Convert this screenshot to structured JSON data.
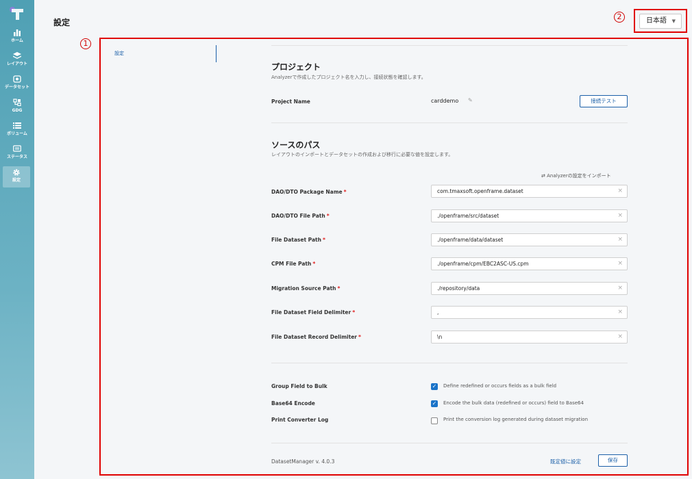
{
  "colors": {
    "accent": "#1a5fa8",
    "annotation": "#e00000",
    "required": "#e02020"
  },
  "sidebar": {
    "items": [
      {
        "icon": "bar-chart-icon",
        "label": "ホーム"
      },
      {
        "icon": "layers-icon",
        "label": "レイアウト"
      },
      {
        "icon": "dataset-icon",
        "label": "データセット"
      },
      {
        "icon": "gdg-icon",
        "label": "GDG"
      },
      {
        "icon": "list-icon",
        "label": "ボリューム"
      },
      {
        "icon": "status-icon",
        "label": "ステータス"
      },
      {
        "icon": "gear-icon",
        "label": "設定"
      }
    ]
  },
  "header": {
    "title": "設定",
    "language": "日本語"
  },
  "annotations": {
    "one": "1",
    "two": "2"
  },
  "side_nav": {
    "item": "設定"
  },
  "project": {
    "title": "プロジェクト",
    "desc": "Analyzerで作成したプロジェクト名を入力し、接続状態を確認します。",
    "name_label": "Project Name",
    "name_value": "carddemo",
    "test_button": "接続テスト"
  },
  "source": {
    "title": "ソースのパス",
    "desc": "レイアウトのインポートとデータセットの作成および移行に必要な値を設定します。",
    "import_label": "Analyzerの設定をインポート",
    "fields": [
      {
        "label": "DAO/DTO Package Name",
        "value": "com.tmaxsoft.openframe.dataset"
      },
      {
        "label": "DAO/DTO File Path",
        "value": "./openframe/src/dataset"
      },
      {
        "label": "File Dataset Path",
        "value": "./openframe/data/dataset"
      },
      {
        "label": "CPM File Path",
        "value": "./openframe/cpm/EBC2ASC-US.cpm"
      },
      {
        "label": "Migration Source Path",
        "value": "./repository/data"
      },
      {
        "label": "File Dataset Field Delimiter",
        "value": ","
      },
      {
        "label": "File Dataset Record Delimiter",
        "value": "\\n"
      }
    ]
  },
  "options": [
    {
      "label": "Group Field to Bulk",
      "checked": true,
      "text": "Define redefined or occurs fields as a bulk field"
    },
    {
      "label": "Base64 Encode",
      "checked": true,
      "text": "Encode the bulk data (redefined or occurs) field to Base64"
    },
    {
      "label": "Print Converter Log",
      "checked": false,
      "text": "Print the conversion log generated during dataset migration"
    }
  ],
  "footer": {
    "version": "DatasetManager v. 4.0.3",
    "reset": "既定値に設定",
    "save": "保存"
  }
}
